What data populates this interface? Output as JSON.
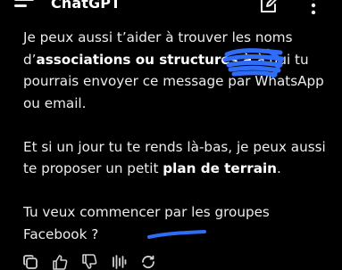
{
  "header": {
    "app_title": "ChatGPT",
    "menu_icon": "hamburger-menu-icon",
    "edit_icon": "edit-pencil-icon",
    "more_icon": "vertical-dots-icon"
  },
  "message": {
    "p1_before": "Je peux aussi t’aider à trouver les noms d’",
    "p1_bold": "associations ou structures à ",
    "p1_after": " à qui tu pourrais envoyer ce message par WhatsApp ou email.",
    "p2_before": "Et si un jour tu te rends là-bas, je peux aussi te proposer un petit ",
    "p2_bold": "plan de terrain",
    "p2_after": ".",
    "p3": "Tu veux commencer par les groupes Facebook ?"
  },
  "annotations": {
    "redaction_color": "#2f6df6",
    "underline_color": "#2f6df6"
  },
  "actions": {
    "icons": [
      "copy-icon",
      "thumbs-up-icon",
      "thumbs-down-icon",
      "speaker-icon",
      "regenerate-icon"
    ]
  },
  "colors": {
    "background": "#000000",
    "text": "#ececec",
    "accent_blue": "#2f6df6"
  }
}
